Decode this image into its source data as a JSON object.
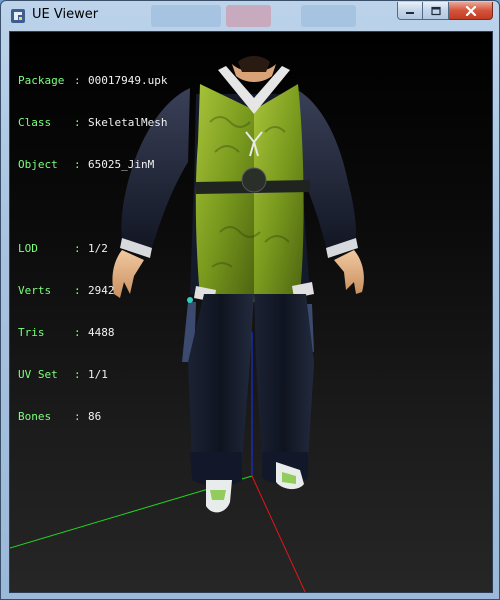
{
  "window": {
    "title": "UE Viewer",
    "caption_buttons": {
      "minimize_icon": "minimize-icon",
      "maximize_icon": "maximize-icon",
      "close_icon": "close-icon"
    }
  },
  "info": {
    "package": {
      "key": "Package",
      "value": "00017949.upk"
    },
    "class": {
      "key": "Class",
      "value": "SkeletalMesh"
    },
    "object": {
      "key": "Object",
      "value": "65025_JinM"
    },
    "lod": {
      "key": "LOD",
      "value": "1/2"
    },
    "verts": {
      "key": "Verts",
      "value": "2942"
    },
    "tris": {
      "key": "Tris",
      "value": "4488"
    },
    "uvset": {
      "key": "UV Set",
      "value": "1/1"
    },
    "bones": {
      "key": "Bones",
      "value": "86"
    }
  },
  "colors": {
    "label": "#7dff7d",
    "value": "#f2f2f2",
    "axis_x": "#e01818",
    "axis_y": "#22d422",
    "axis_z": "#1a30ff",
    "vest": "#7a9a1e",
    "robe": "#15192a"
  }
}
